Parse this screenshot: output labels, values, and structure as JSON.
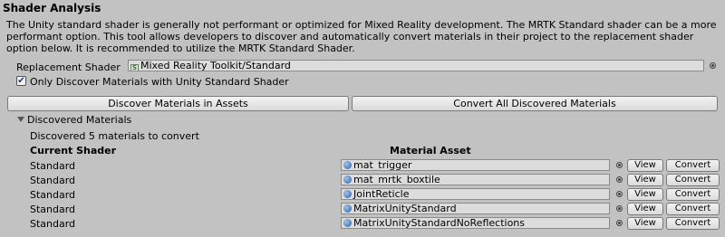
{
  "section_title": "Shader Analysis",
  "description": "The Unity standard shader is generally not performant or optimized for Mixed Reality development. The MRTK Standard shader can be a more performant option. This tool allows developers to discover and automatically convert materials in their project to the replacement shader option below. It is recommended to utilize the MRTK Standard Shader.",
  "replacement": {
    "label": "Replacement Shader",
    "value": "Mixed Reality Toolkit/Standard",
    "icon": "shader-icon"
  },
  "only_discover": {
    "label": "Only Discover Materials with Unity Standard Shader",
    "checked": true
  },
  "buttons": {
    "discover": "Discover Materials in Assets",
    "convert_all": "Convert All Discovered Materials"
  },
  "discovered": {
    "foldout_label": "Discovered Materials",
    "count_text": "Discovered 5 materials to convert",
    "col_shader": "Current Shader",
    "col_asset": "Material Asset",
    "view_label": "View",
    "convert_label": "Convert",
    "rows": [
      {
        "shader": "Standard",
        "asset": "mat_trigger"
      },
      {
        "shader": "Standard",
        "asset": "mat_mrtk_boxtile"
      },
      {
        "shader": "Standard",
        "asset": "JointReticle"
      },
      {
        "shader": "Standard",
        "asset": "MatrixUnityStandard"
      },
      {
        "shader": "Standard",
        "asset": "MatrixUnityStandardNoReflections"
      }
    ]
  }
}
